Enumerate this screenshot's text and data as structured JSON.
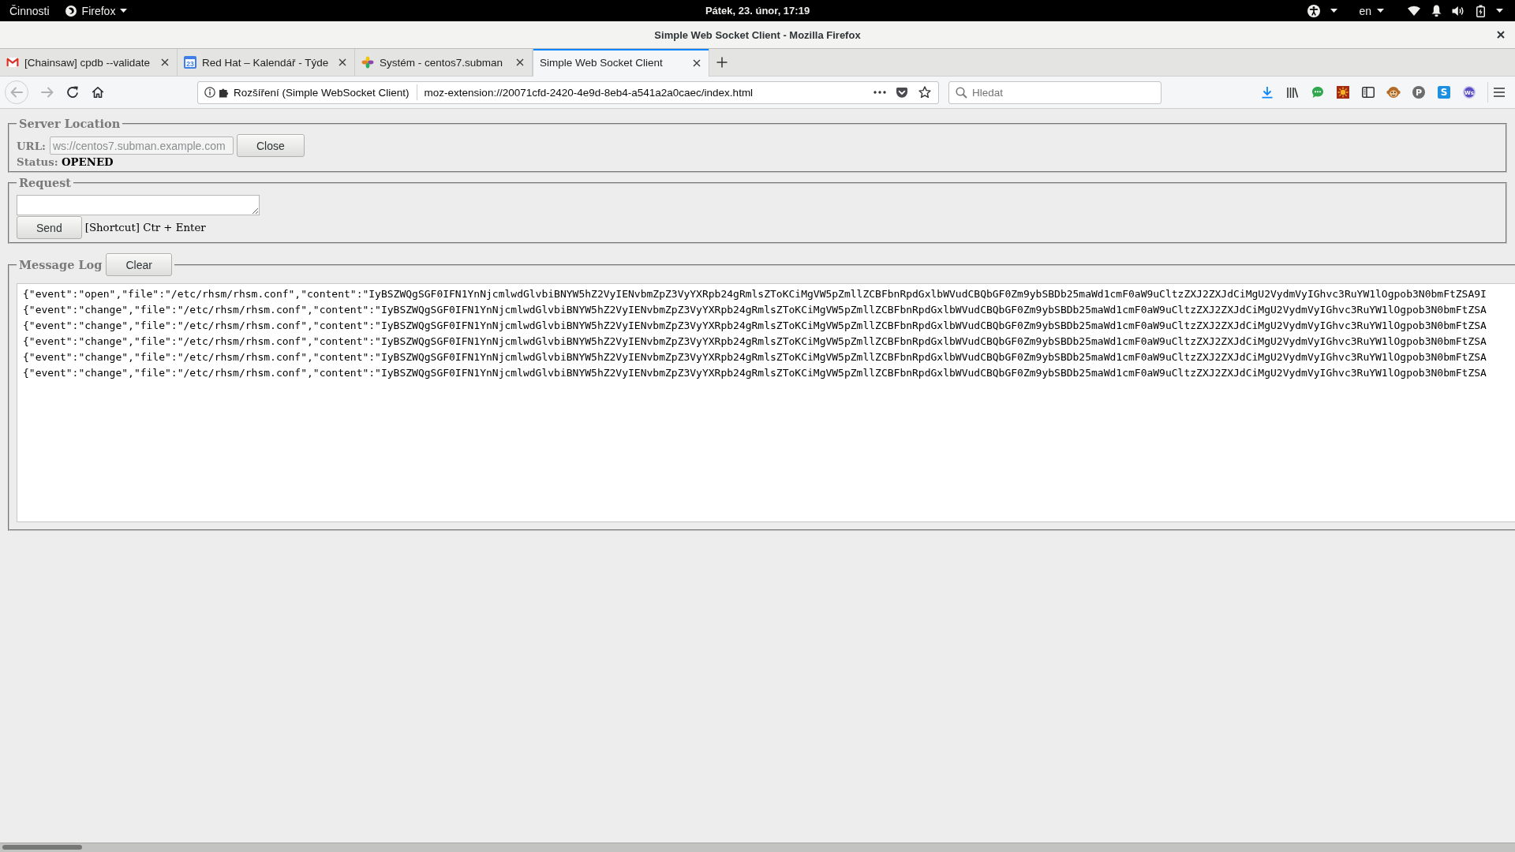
{
  "top_bar": {
    "activities": "Činnosti",
    "app_menu": "Firefox",
    "clock": "Pátek, 23. únor, 17:19",
    "keyboard_layout": "en"
  },
  "window": {
    "title": "Simple Web Socket Client - Mozilla Firefox"
  },
  "tabs": [
    {
      "kind": "envelope",
      "title": "[Chainsaw] cpdb --validate",
      "selected": false
    },
    {
      "kind": "calendar",
      "icon_text": "23",
      "title": "Red Hat – Kalendář - Týde",
      "selected": false
    },
    {
      "kind": "pinwheel",
      "title": "Systém - centos7.subman",
      "selected": false
    },
    {
      "kind": "plain",
      "title": "Simple Web Socket Client",
      "selected": true
    }
  ],
  "back_button": {
    "disabled": true
  },
  "forward_button": {
    "disabled": true
  },
  "address_bar": {
    "identity": "Rozšíření (Simple WebSocket Client)",
    "url": "moz-extension://20071cfd-2420-4e9d-8eb4-a541a2a0caec/index.html"
  },
  "search": {
    "placeholder": "Hledat"
  },
  "toolbar_icons": [
    {
      "kind": "download"
    },
    {
      "kind": "library"
    },
    {
      "kind": "chat"
    },
    {
      "kind": "sun"
    },
    {
      "kind": "sidebar"
    },
    {
      "kind": "monkey"
    },
    {
      "kind": "letter-circle",
      "glyph": "P"
    },
    {
      "kind": "letter-tile",
      "glyph": "S"
    },
    {
      "kind": "letter-ring",
      "glyph": "Ws"
    }
  ],
  "server_location": {
    "legend": "Server Location",
    "url_label": "URL:",
    "url_value": "ws://centos7.subman.example.com",
    "url_disabled": true,
    "connect_button": "Close",
    "status_label": "Status:",
    "status": "OPENED"
  },
  "request": {
    "legend": "Request",
    "send_button": "Send",
    "hint": "[Shortcut] Ctr + Enter"
  },
  "message_log": {
    "legend": "Message Log",
    "clear_button": "Clear",
    "messages": [
      "{\"event\":\"open\",\"file\":\"/etc/rhsm/rhsm.conf\",\"content\":\"IyBSZWQgSGF0IFN1YnNjcmlwdGlvbiBNYW5hZ2VyIENvbmZpZ3VyYXRpb24gRmlsZToKCiMgVW5pZmllZCBFbnRpdGxlbWVudCBQbGF0Zm9ybSBDb25maWd1cmF0aW9uCltzZXJ2ZXJdCiMgU2VydmVyIGhvc3RuYW1lOgpob3N0bmFtZSA9I",
      "{\"event\":\"change\",\"file\":\"/etc/rhsm/rhsm.conf\",\"content\":\"IyBSZWQgSGF0IFN1YnNjcmlwdGlvbiBNYW5hZ2VyIENvbmZpZ3VyYXRpb24gRmlsZToKCiMgVW5pZmllZCBFbnRpdGxlbWVudCBQbGF0Zm9ybSBDb25maWd1cmF0aW9uCltzZXJ2ZXJdCiMgU2VydmVyIGhvc3RuYW1lOgpob3N0bmFtZSA",
      "{\"event\":\"change\",\"file\":\"/etc/rhsm/rhsm.conf\",\"content\":\"IyBSZWQgSGF0IFN1YnNjcmlwdGlvbiBNYW5hZ2VyIENvbmZpZ3VyYXRpb24gRmlsZToKCiMgVW5pZmllZCBFbnRpdGxlbWVudCBQbGF0Zm9ybSBDb25maWd1cmF0aW9uCltzZXJ2ZXJdCiMgU2VydmVyIGhvc3RuYW1lOgpob3N0bmFtZSA",
      "{\"event\":\"change\",\"file\":\"/etc/rhsm/rhsm.conf\",\"content\":\"IyBSZWQgSGF0IFN1YnNjcmlwdGlvbiBNYW5hZ2VyIENvbmZpZ3VyYXRpb24gRmlsZToKCiMgVW5pZmllZCBFbnRpdGxlbWVudCBQbGF0Zm9ybSBDb25maWd1cmF0aW9uCltzZXJ2ZXJdCiMgU2VydmVyIGhvc3RuYW1lOgpob3N0bmFtZSA",
      "{\"event\":\"change\",\"file\":\"/etc/rhsm/rhsm.conf\",\"content\":\"IyBSZWQgSGF0IFN1YnNjcmlwdGlvbiBNYW5hZ2VyIENvbmZpZ3VyYXRpb24gRmlsZToKCiMgVW5pZmllZCBFbnRpdGxlbWVudCBQbGF0Zm9ybSBDb25maWd1cmF0aW9uCltzZXJ2ZXJdCiMgU2VydmVyIGhvc3RuYW1lOgpob3N0bmFtZSA",
      "{\"event\":\"change\",\"file\":\"/etc/rhsm/rhsm.conf\",\"content\":\"IyBSZWQgSGF0IFN1YnNjcmlwdGlvbiBNYW5hZ2VyIENvbmZpZ3VyYXRpb24gRmlsZToKCiMgVW5pZmllZCBFbnRpdGxlbWVudCBQbGF0Zm9ybSBDb25maWd1cmF0aW9uCltzZXJ2ZXJdCiMgU2VydmVyIGhvc3RuYW1lOgpob3N0bmFtZSA"
    ]
  }
}
